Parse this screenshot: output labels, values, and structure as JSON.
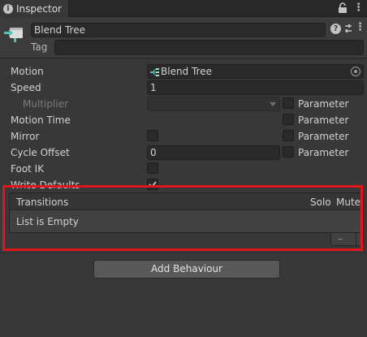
{
  "tab": {
    "title": "Inspector",
    "icon": "info-icon"
  },
  "header": {
    "name": "Blend Tree",
    "tag_label": "Tag",
    "tag_value": ""
  },
  "properties": {
    "motion": {
      "label": "Motion",
      "value": "Blend Tree"
    },
    "speed": {
      "label": "Speed",
      "value": "1"
    },
    "multiplier": {
      "label": "Multiplier",
      "value": ""
    },
    "motion_time": {
      "label": "Motion Time"
    },
    "mirror": {
      "label": "Mirror"
    },
    "cycle_offset": {
      "label": "Cycle Offset",
      "value": "0"
    },
    "foot_ik": {
      "label": "Foot IK"
    },
    "write_defaults": {
      "label": "Write Defaults",
      "checked": true
    }
  },
  "parameter_label": "Parameter",
  "transitions": {
    "title": "Transitions",
    "solo": "Solo",
    "mute": "Mute",
    "empty_text": "List is Empty",
    "remove_label": "–"
  },
  "add_behaviour_label": "Add Behaviour",
  "colors": {
    "highlight": "#e2161a",
    "background": "#383838",
    "accent_icon": "#4fc3b4"
  }
}
